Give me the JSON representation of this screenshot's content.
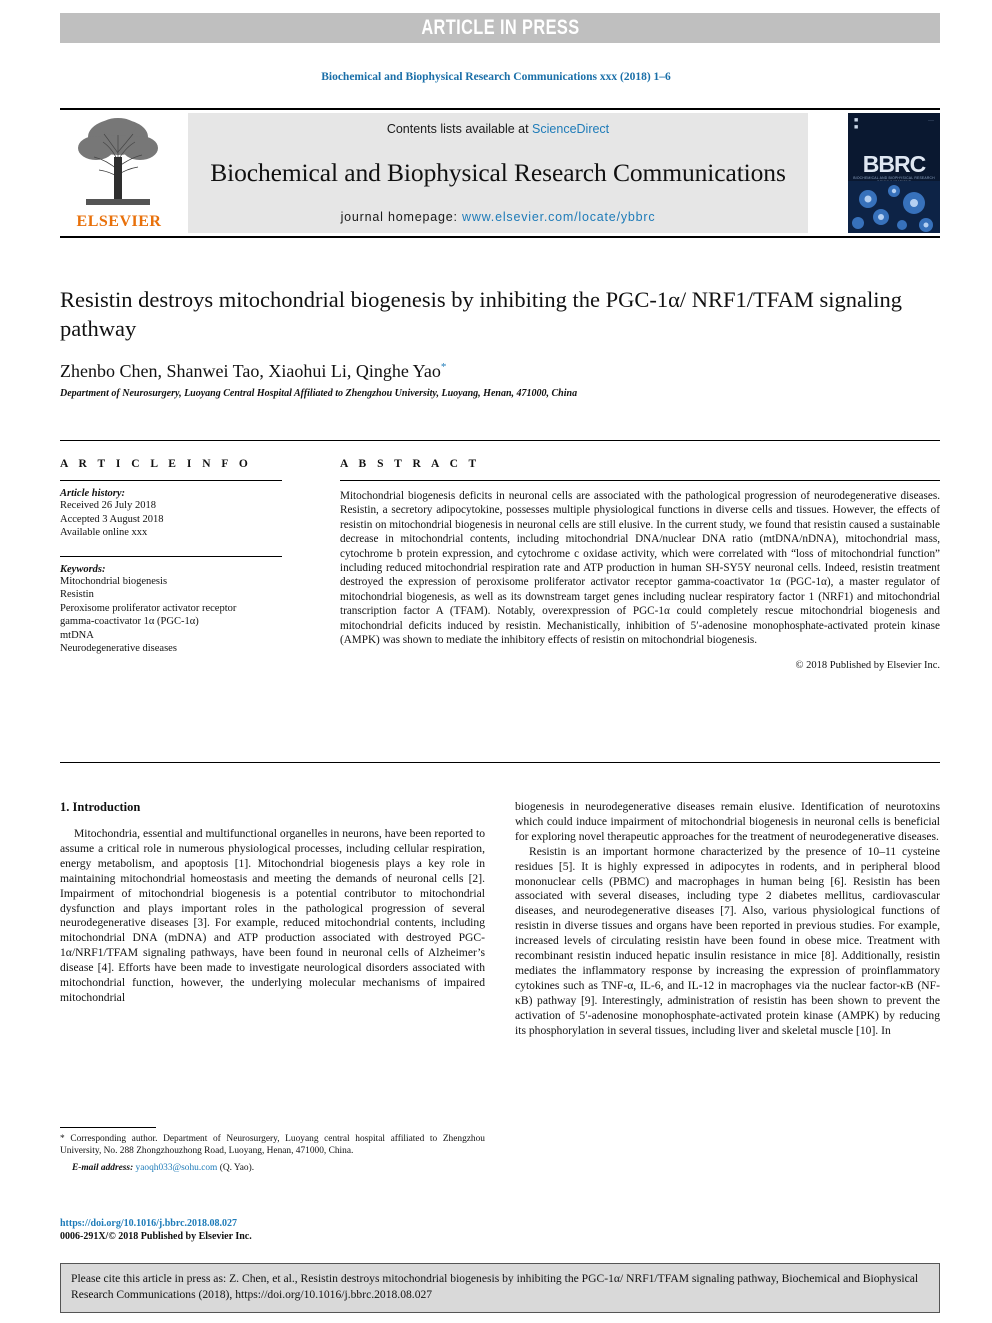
{
  "banner": {
    "label": "ARTICLE IN PRESS"
  },
  "running_head": "Biochemical and Biophysical Research Communications xxx (2018) 1–6",
  "masthead": {
    "contents_prefix": "Contents lists available at ",
    "contents_link": "ScienceDirect",
    "journal_title": "Biochemical and Biophysical Research Communications",
    "homepage_label": "journal homepage: ",
    "homepage_url": "www.elsevier.com/locate/ybbrc",
    "publisher_name": "ELSEVIER",
    "journal_badge": "BBRC",
    "journal_badge_sub": "BIOCHEMICAL AND BIOPHYSICAL RESEARCH COMMUNICATIONS",
    "accent_link_color": "#1e7bb8",
    "banner_gray": "#bfbfbf",
    "masthead_gray": "#e6e6e6"
  },
  "article": {
    "title": "Resistin destroys mitochondrial biogenesis by inhibiting the PGC-1α/ NRF1/TFAM signaling pathway",
    "authors": "Zhenbo Chen, Shanwei Tao, Xiaohui Li, Qinghe Yao",
    "corresponding_marker": "*",
    "affiliation": "Department of Neurosurgery, Luoyang Central Hospital Affiliated to Zhengzhou University, Luoyang, Henan, 471000, China"
  },
  "article_info": {
    "heading": "A R T I C L E   I N F O",
    "history_label": "Article history:",
    "history": [
      "Received 26 July 2018",
      "Accepted 3 August 2018",
      "Available online xxx"
    ],
    "keywords_label": "Keywords:",
    "keywords": [
      "Mitochondrial biogenesis",
      "Resistin",
      "Peroxisome proliferator activator receptor",
      "gamma-coactivator 1α (PGC-1α)",
      "mtDNA",
      "Neurodegenerative diseases"
    ]
  },
  "abstract": {
    "heading": "A B S T R A C T",
    "text": "Mitochondrial biogenesis deficits in neuronal cells are associated with the pathological progression of neurodegenerative diseases. Resistin, a secretory adipocytokine, possesses multiple physiological functions in diverse cells and tissues. However, the effects of resistin on mitochondrial biogenesis in neuronal cells are still elusive. In the current study, we found that resistin caused a sustainable decrease in mitochondrial contents, including mitochondrial DNA/nuclear DNA ratio (mtDNA/nDNA), mitochondrial mass, cytochrome b protein expression, and cytochrome c oxidase activity, which were correlated with “loss of mitochondrial function” including reduced mitochondrial respiration rate and ATP production in human SH-SY5Y neuronal cells. Indeed, resistin treatment destroyed the expression of peroxisome proliferator activator receptor gamma-coactivator 1α (PGC-1α), a master regulator of mitochondrial biogenesis, as well as its downstream target genes including nuclear respiratory factor 1 (NRF1) and mitochondrial transcription factor A (TFAM). Notably, overexpression of PGC-1α could completely rescue mitochondrial biogenesis and mitochondrial deficits induced by resistin. Mechanistically, inhibition of 5′-adenosine monophosphate-activated protein kinase (AMPK) was shown to mediate the inhibitory effects of resistin on mitochondrial biogenesis.",
    "copyright": "© 2018 Published by Elsevier Inc."
  },
  "sections": {
    "intro_heading": "1.  Introduction",
    "left_para_1": "Mitochondria, essential and multifunctional organelles in neurons, have been reported to assume a critical role in numerous physiological processes, including cellular respiration, energy metabolism, and apoptosis [1]. Mitochondrial biogenesis plays a key role in maintaining mitochondrial homeostasis and meeting the demands of neuronal cells [2]. Impairment of mitochondrial biogenesis is a potential contributor to mitochondrial dysfunction and plays important roles in the pathological progression of several neurodegenerative diseases [3]. For example, reduced mitochondrial contents, including mitochondrial DNA (mDNA) and ATP production associated with destroyed PGC-1α/NRF1/TFAM signaling pathways, have been found in neuronal cells of Alzheimer’s disease [4]. Efforts have been made to investigate neurological disorders associated with mitochondrial function, however, the underlying molecular mechanisms of impaired mitochondrial",
    "right_para_1": "biogenesis in neurodegenerative diseases remain elusive. Identification of neurotoxins which could induce impairment of mitochondrial biogenesis in neuronal cells is beneficial for exploring novel therapeutic approaches for the treatment of neurodegenerative diseases.",
    "right_para_2": "Resistin is an important hormone characterized by the presence of 10–11 cysteine residues [5]. It is highly expressed in adipocytes in rodents, and in peripheral blood mononuclear cells (PBMC) and macrophages in human being [6]. Resistin has been associated with several diseases, including type 2 diabetes mellitus, cardiovascular diseases, and neurodegenerative diseases [7]. Also, various physiological functions of resistin in diverse tissues and organs have been reported in previous studies. For example, increased levels of circulating resistin have been found in obese mice. Treatment with recombinant resistin induced hepatic insulin resistance in mice [8]. Additionally, resistin mediates the inflammatory response by increasing the expression of proinflammatory cytokines such as TNF-α, IL-6, and IL-12 in macrophages via the nuclear factor-κB (NF-κB) pathway [9]. Interestingly, administration of resistin has been shown to prevent the activation of 5′-adenosine monophosphate-activated protein kinase (AMPK) by reducing its phosphorylation in several tissues, including liver and skeletal muscle [10]. In"
  },
  "footnote": {
    "corresponding": "* Corresponding author. Department of Neurosurgery, Luoyang central hospital affiliated to Zhengzhou University, No. 288 Zhongzhouzhong Road, Luoyang, Henan, 471000, China.",
    "email_label": "E-mail address: ",
    "email": "yaoqh033@sohu.com",
    "email_suffix": " (Q. Yao)."
  },
  "doi": {
    "link": "https://doi.org/10.1016/j.bbrc.2018.08.027",
    "issn": "0006-291X/© 2018 Published by Elsevier Inc."
  },
  "citation_box": {
    "text": "Please cite this article in press as: Z. Chen, et al., Resistin destroys mitochondrial biogenesis by inhibiting the PGC-1α/ NRF1/TFAM signaling pathway, Biochemical and Biophysical Research Communications (2018), https://doi.org/10.1016/j.bbrc.2018.08.027"
  }
}
